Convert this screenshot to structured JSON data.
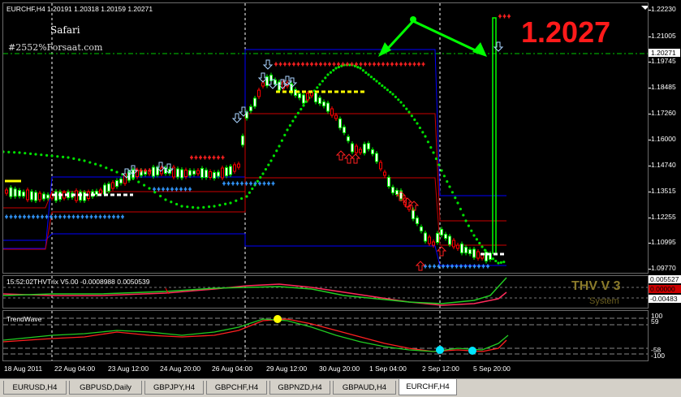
{
  "chart": {
    "symbol_header": "EURCHF,H4  1.20191 1.20318 1.20159 1.20271",
    "indicator_safari": "Safari",
    "watermark": "#2552%Forsaat.com",
    "big_price": "1.2027",
    "current_price_tag": "1.20271"
  },
  "price_axis": {
    "labels": [
      "1.22230",
      "1.21005",
      "1.19745",
      "1.18485",
      "1.17260",
      "1.16000",
      "1.14740",
      "1.13515",
      "1.12255",
      "1.10995",
      "1.09770"
    ]
  },
  "thv_pane": {
    "label": "15:52:02THVTrix V5.00 -0.0008988 0.0050539",
    "title": "THV V 3",
    "subtitle": "System",
    "axis_labels": [
      "0.005527",
      "0.00000",
      "-0.00483"
    ]
  },
  "trendwave_pane": {
    "label": "TrendWave",
    "axis_labels": [
      "100",
      "59",
      "-58",
      "-100"
    ]
  },
  "time_axis": {
    "labels": [
      "18 Aug 2011",
      "22 Aug 04:00",
      "23 Aug 12:00",
      "24 Aug 20:00",
      "26 Aug 04:00",
      "29 Aug 12:00",
      "30 Aug 20:00",
      "1 Sep 04:00",
      "2 Sep 12:00",
      "5 Sep 20:00"
    ]
  },
  "tabs": [
    {
      "label": "EURUSD,H4",
      "active": false
    },
    {
      "label": "GBPUSD,Daily",
      "active": false
    },
    {
      "label": "GBPJPY,H4",
      "active": false
    },
    {
      "label": "GBPCHF,H4",
      "active": false
    },
    {
      "label": "GBPNZD,H4",
      "active": false
    },
    {
      "label": "GBPAUD,H4",
      "active": false
    },
    {
      "label": "EURCHF,H4",
      "active": true
    }
  ],
  "colors": {
    "bull_candle": "#00ff00",
    "bear_candle": "#ff0000",
    "grid": "#6a6a6a",
    "accent_big_price": "#ff1a1a",
    "trendline": "#00ff00",
    "band_blue": "#0000ff",
    "band_red": "#cc0000",
    "arrow_blue": "#3399ff",
    "arrow_red": "#ff2020",
    "signal_yellow": "#ffff00"
  }
}
